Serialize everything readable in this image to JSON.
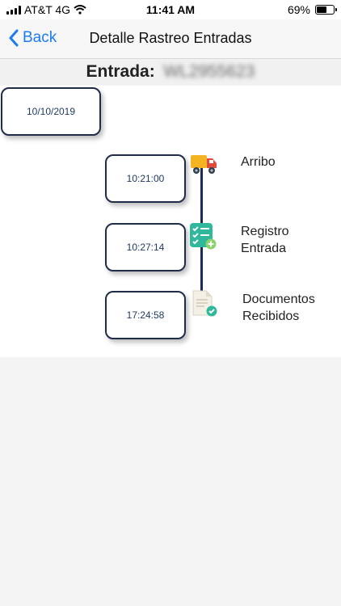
{
  "status_bar": {
    "carrier": "AT&T 4G",
    "time": "11:41 AM",
    "battery": "69%",
    "battery_level": 0.69
  },
  "nav": {
    "back_label": "Back",
    "title": "Detalle Rastreo Entradas"
  },
  "entry": {
    "label": "Entrada:",
    "value": "WL2955623"
  },
  "date": "10/10/2019",
  "steps": [
    {
      "time": "10:21:00",
      "label": "Arribo",
      "icon": "truck-icon"
    },
    {
      "time": "10:27:14",
      "label": "Registro Entrada",
      "icon": "checklist-icon"
    },
    {
      "time": "17:24:58",
      "label": "Documentos Recibidos",
      "icon": "document-check-icon"
    }
  ]
}
